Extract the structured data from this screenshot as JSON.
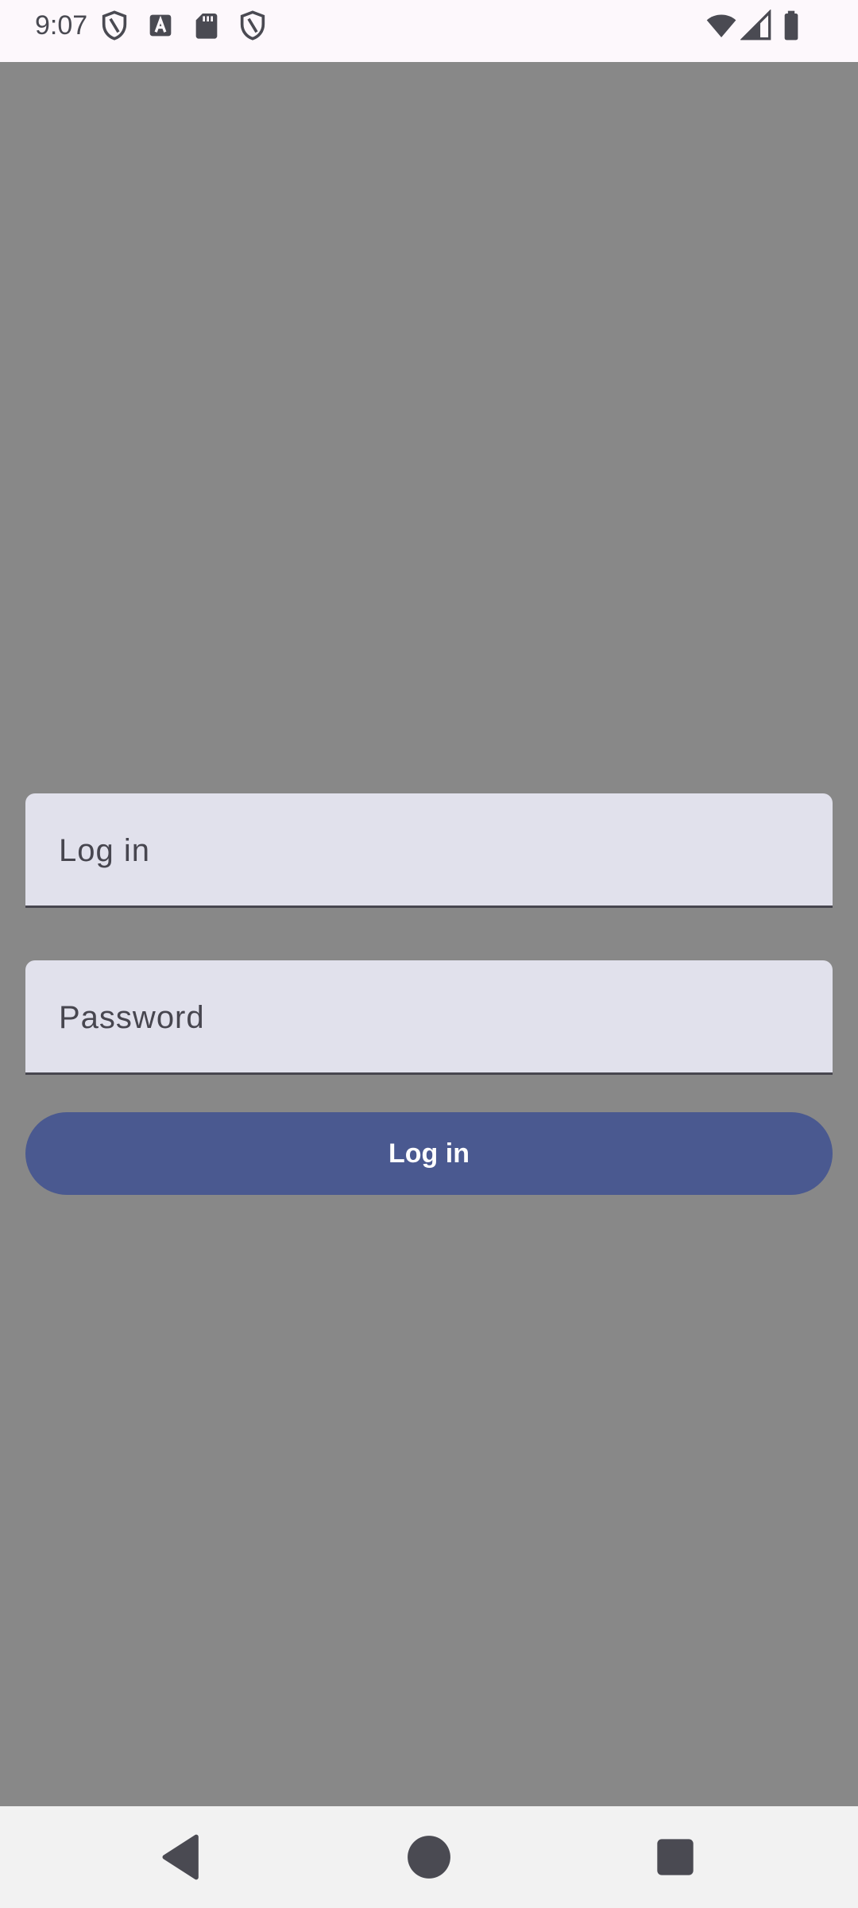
{
  "status_bar": {
    "time": "9:07",
    "left_icons": [
      "shield-icon",
      "font-a-icon",
      "sd-card-icon",
      "shield-icon"
    ],
    "right_icons": [
      "wifi-icon",
      "cellular-signal-icon",
      "battery-icon"
    ]
  },
  "form": {
    "login_placeholder": "Log in",
    "password_placeholder": "Password",
    "submit_label": "Log in"
  },
  "navigation_bar": {
    "buttons": [
      "back-icon",
      "home-icon",
      "recents-icon"
    ]
  },
  "colors": {
    "scrim": "#888888",
    "field_background": "#e1e1ec",
    "button_primary": "#4a5990",
    "status_bar_background": "#fdf8fc",
    "nav_bar_background": "#f2f2f2",
    "icon_dark": "#4a4a52"
  }
}
